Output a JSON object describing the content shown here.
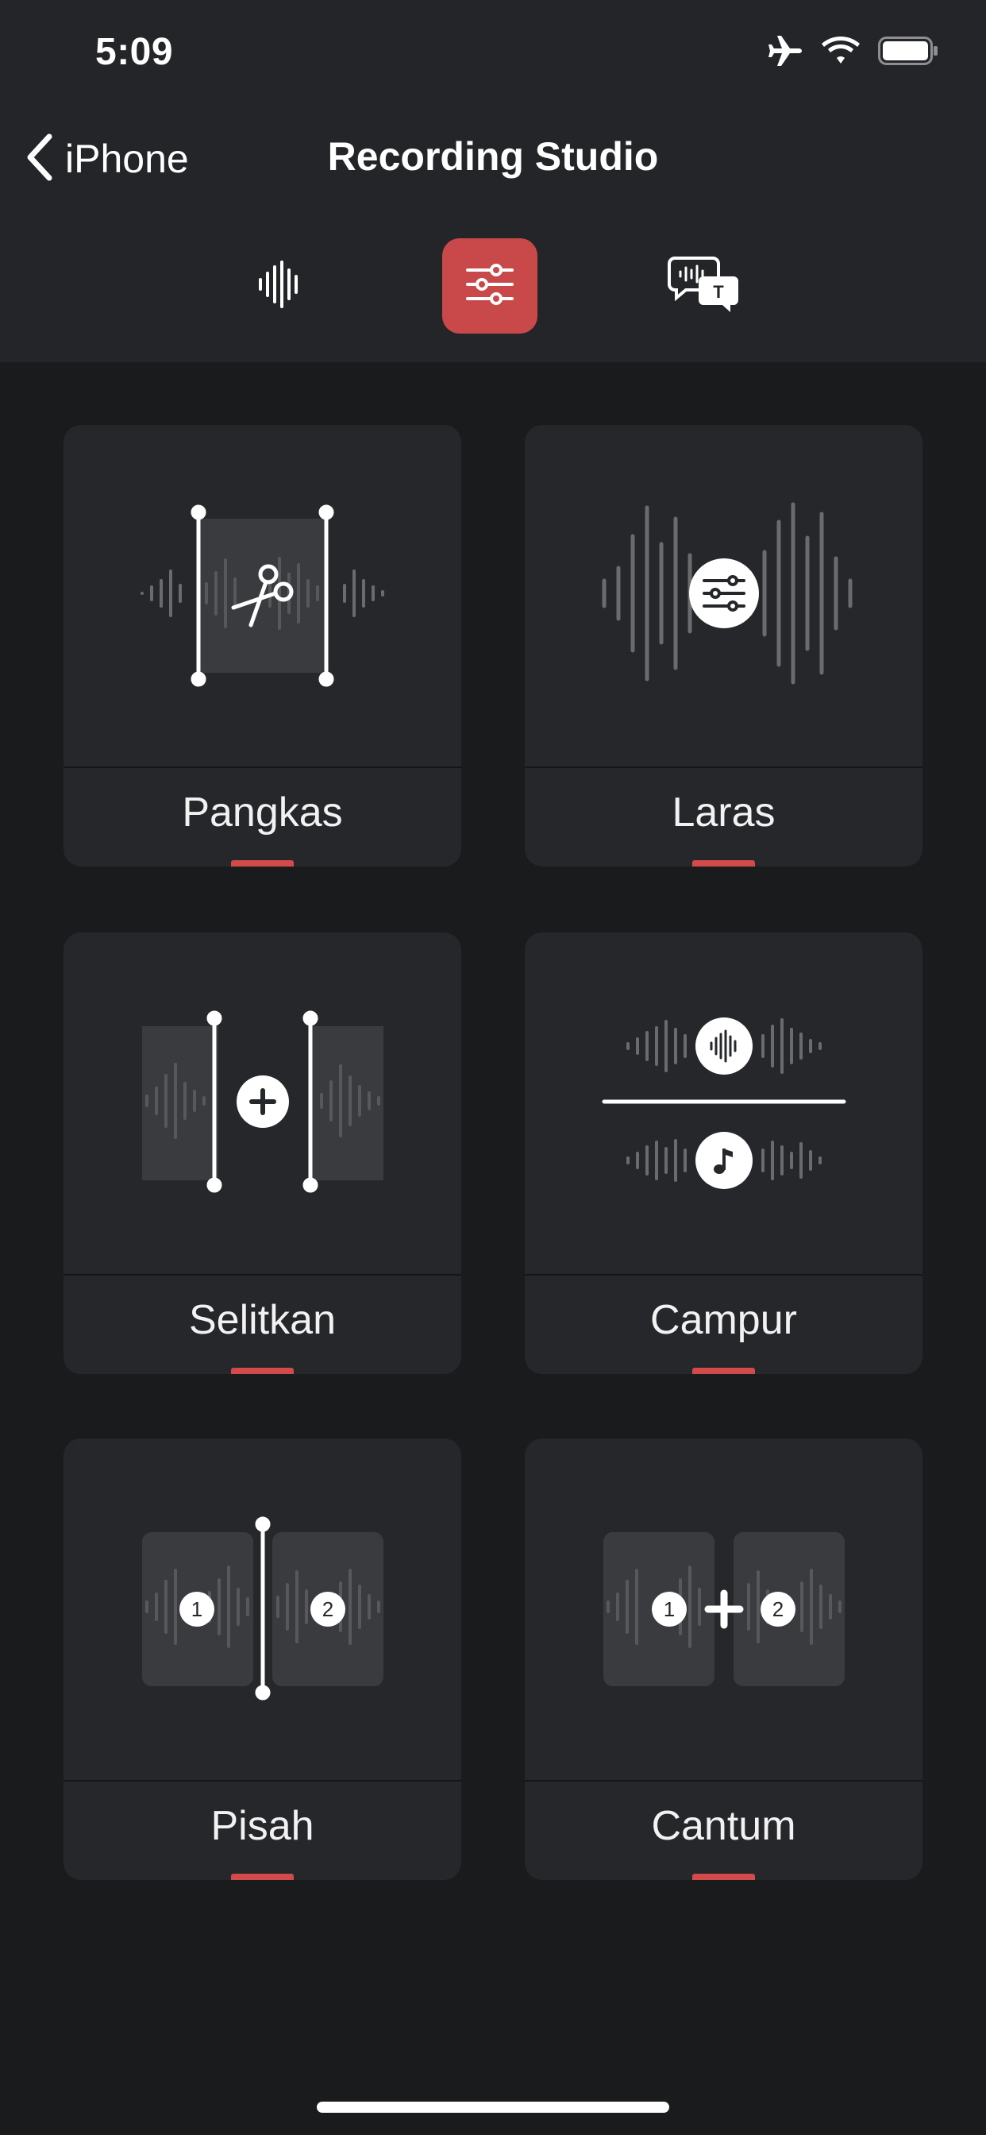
{
  "status_bar": {
    "time": "5:09",
    "icons": [
      "airplane-mode-icon",
      "wifi-icon",
      "battery-icon"
    ]
  },
  "nav": {
    "back_label": "iPhone",
    "title": "Recording Studio"
  },
  "segments": [
    {
      "icon": "waveform-icon",
      "active": false
    },
    {
      "icon": "sliders-icon",
      "active": true
    },
    {
      "icon": "transcript-bubble-icon",
      "active": false
    }
  ],
  "tools": [
    {
      "label": "Pangkas",
      "icon": "trim-scissors-icon"
    },
    {
      "label": "Laras",
      "icon": "adjust-sliders-icon"
    },
    {
      "label": "Selitkan",
      "icon": "insert-plus-icon"
    },
    {
      "label": "Campur",
      "icon": "mix-voice-music-icon"
    },
    {
      "label": "Pisah",
      "icon": "split-icon"
    },
    {
      "label": "Cantum",
      "icon": "join-icon"
    }
  ],
  "badges": {
    "one": "1",
    "two": "2"
  },
  "colors": {
    "background": "#1a1b1d",
    "header": "#242528",
    "card": "#26272b",
    "accent": "#c9494a",
    "waveform": "#6a6b6f"
  }
}
